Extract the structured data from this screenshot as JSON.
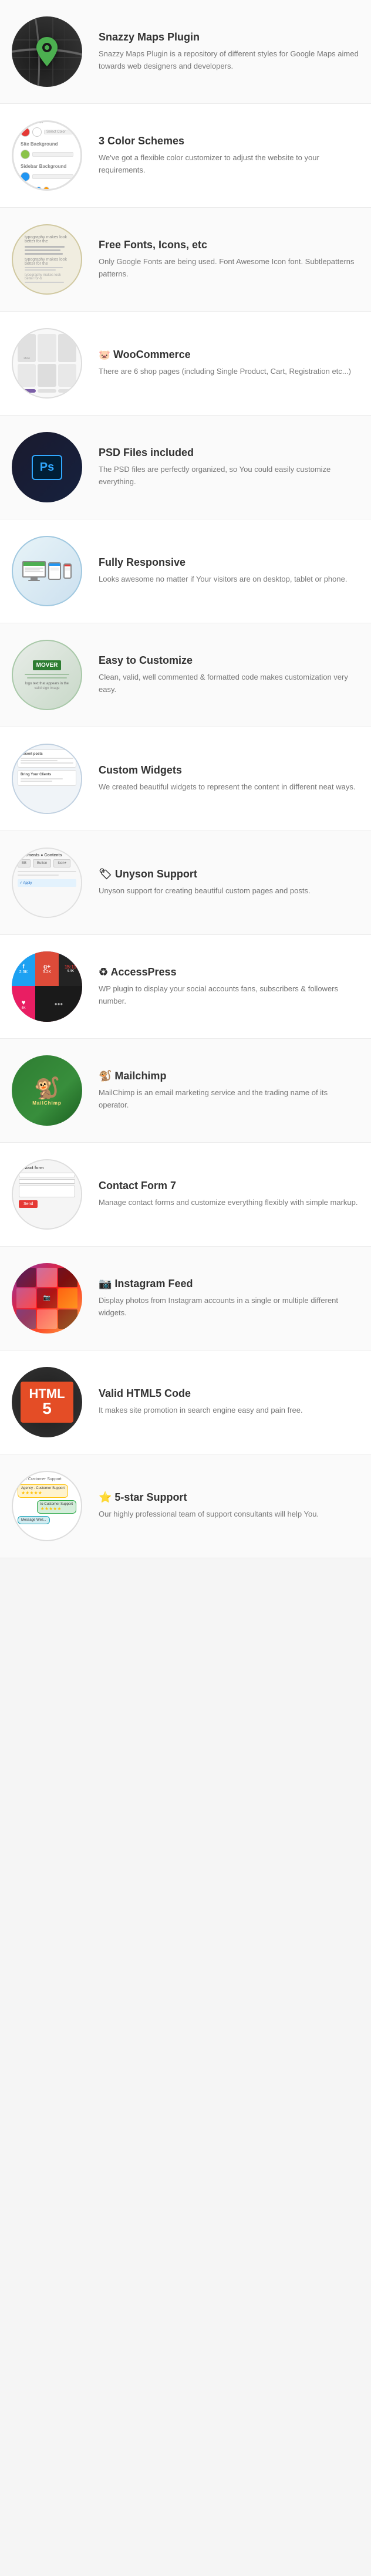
{
  "features": [
    {
      "id": "snazzy-maps",
      "title": "Snazzy Maps Plugin",
      "desc": "Snazzy Maps Plugin is a repository of different styles for Google Maps aimed towards web designers and developers.",
      "imgType": "snazzy",
      "emoji": ""
    },
    {
      "id": "color-schemes",
      "title": "3 Color Schemes",
      "desc": "We've got a flexible color customizer to adjust the website to your requirements.",
      "imgType": "colors",
      "emoji": ""
    },
    {
      "id": "free-fonts",
      "title": "Free Fonts, Icons, etc",
      "desc": "Only Google Fonts are being used. Font Awesome Icon font. Subtlepatterns patterns.",
      "imgType": "fonts",
      "emoji": ""
    },
    {
      "id": "woocommerce",
      "title": "WooCommerce",
      "desc": "There are 6 shop pages (including Single Product, Cart, Registration etc...)",
      "imgType": "woo",
      "emoji": "🐷"
    },
    {
      "id": "psd-files",
      "title": "PSD Files included",
      "desc": "The PSD files are perfectly organized, so You could easily customize everything.",
      "imgType": "psd",
      "emoji": ""
    },
    {
      "id": "responsive",
      "title": "Fully Responsive",
      "desc": "Looks awesome no matter if Your visitors are on desktop, tablet or phone.",
      "imgType": "responsive",
      "emoji": ""
    },
    {
      "id": "customize",
      "title": "Easy to Customize",
      "desc": "Clean, valid, well commented & formatted code makes customization very easy.",
      "imgType": "customize",
      "emoji": ""
    },
    {
      "id": "widgets",
      "title": "Custom Widgets",
      "desc": "We created beautiful widgets to represent the content in different neat ways.",
      "imgType": "widgets",
      "emoji": ""
    },
    {
      "id": "unyson",
      "title": "Unyson Support",
      "desc": "Unyson support for creating beautiful custom pages and posts.",
      "imgType": "unyson",
      "emoji": "🏷"
    },
    {
      "id": "accesspress",
      "title": "AccessPress",
      "desc": "WP plugin to display your social accounts fans, subscribers & followers number.",
      "imgType": "accesspress",
      "emoji": "♻"
    },
    {
      "id": "mailchimp",
      "title": "Mailchimp",
      "desc": "MailChimp is an email marketing service and the trading name of its operator.",
      "imgType": "mailchimp",
      "emoji": "🐒"
    },
    {
      "id": "cf7",
      "title": "Contact Form 7",
      "desc": "Manage contact forms and customize everything flexibly with simple markup.",
      "imgType": "cf7",
      "emoji": ""
    },
    {
      "id": "instagram",
      "title": "Instagram Feed",
      "desc": "Display photos from Instagram accounts in a single or multiple different widgets.",
      "imgType": "instagram",
      "emoji": "📷"
    },
    {
      "id": "html5",
      "title": "Valid HTML5 Code",
      "desc": "It makes site promotion in search engine easy and pain free.",
      "imgType": "html5",
      "emoji": ""
    },
    {
      "id": "support",
      "title": "5-star Support",
      "desc": "Our highly professional team of support consultants will help You.",
      "imgType": "support",
      "emoji": "⭐"
    }
  ],
  "colors": {
    "dots1": [
      "#e53935",
      "#8e24aa",
      "#1e88e5"
    ],
    "dots2": [
      "#43a047",
      "#f9a825",
      "#6d4c41"
    ],
    "dots3": [
      "#00acc1",
      "#ff7043",
      "#546e7a"
    ]
  }
}
